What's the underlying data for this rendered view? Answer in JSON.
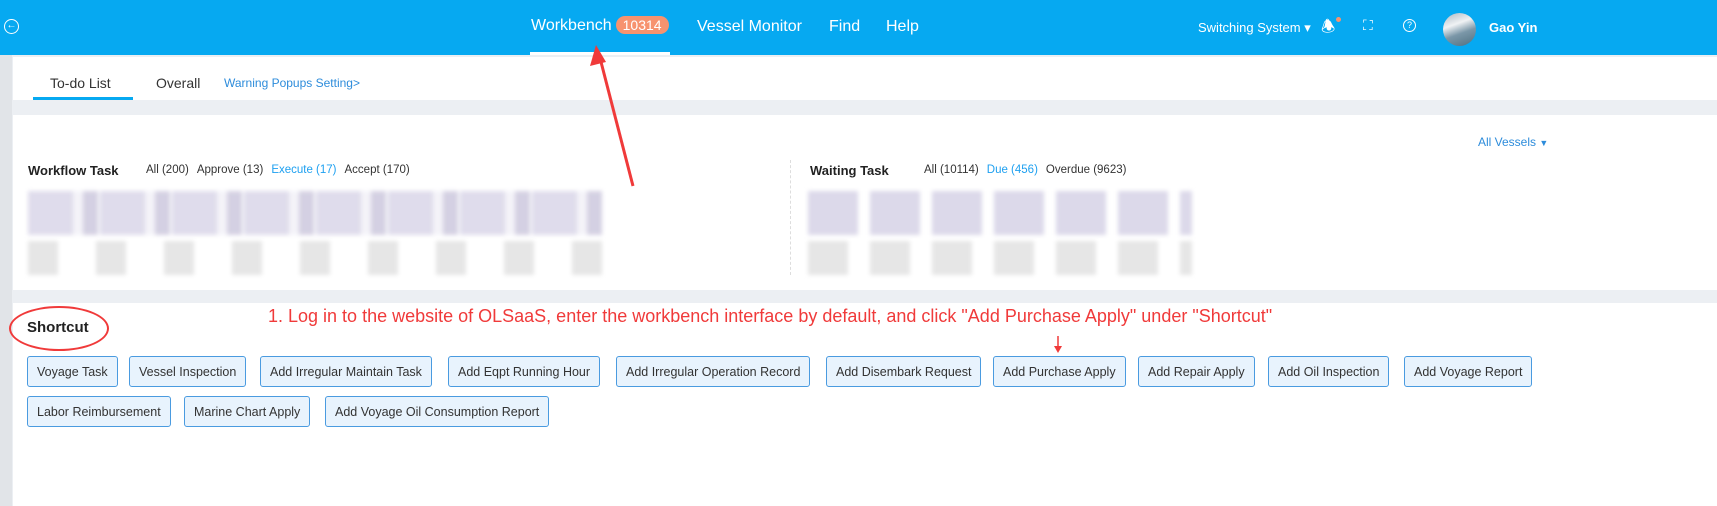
{
  "header": {
    "nav": [
      {
        "label": "Workbench",
        "badge": "10314"
      },
      {
        "label": "Vessel Monitor"
      },
      {
        "label": "Find"
      },
      {
        "label": "Help"
      }
    ],
    "switch_system": "Switching System",
    "user": "Gao Yin",
    "brand_color": "#06a9f1",
    "icons": [
      "back-circle-icon",
      "bell-icon",
      "fullscreen-icon",
      "help-icon",
      "avatar"
    ]
  },
  "tabs": {
    "items": [
      "To-do List",
      "Overall"
    ],
    "active": "To-do List",
    "warning_link": "Warning Popups Setting>"
  },
  "vessel_filter": "All Vessels",
  "workflow": {
    "title": "Workflow Task",
    "filters": [
      "All (200)",
      "Approve (13)",
      "Execute (17)",
      "Accept (170)"
    ],
    "active": "Execute (17)"
  },
  "waiting": {
    "title": "Waiting Task",
    "filters": [
      "All (10114)",
      "Due (456)",
      "Overdue (9623)"
    ],
    "active": "Due (456)"
  },
  "shortcut": {
    "title": "Shortcut",
    "buttons": [
      "Voyage Task",
      "Vessel Inspection",
      "Add Irregular Maintain Task",
      "Add Eqpt Running Hour",
      "Add Irregular Operation Record",
      "Add Disembark Request",
      "Add Purchase Apply",
      "Add Repair Apply",
      "Add Oil Inspection",
      "Add Voyage Report",
      "Labor Reimbursement",
      "Marine Chart Apply",
      "Add Voyage Oil Consumption Report"
    ]
  },
  "annotation": "1. Log in to the website of OLSaaS, enter the workbench interface by default, and click \"Add Purchase Apply\" under \"Shortcut\""
}
